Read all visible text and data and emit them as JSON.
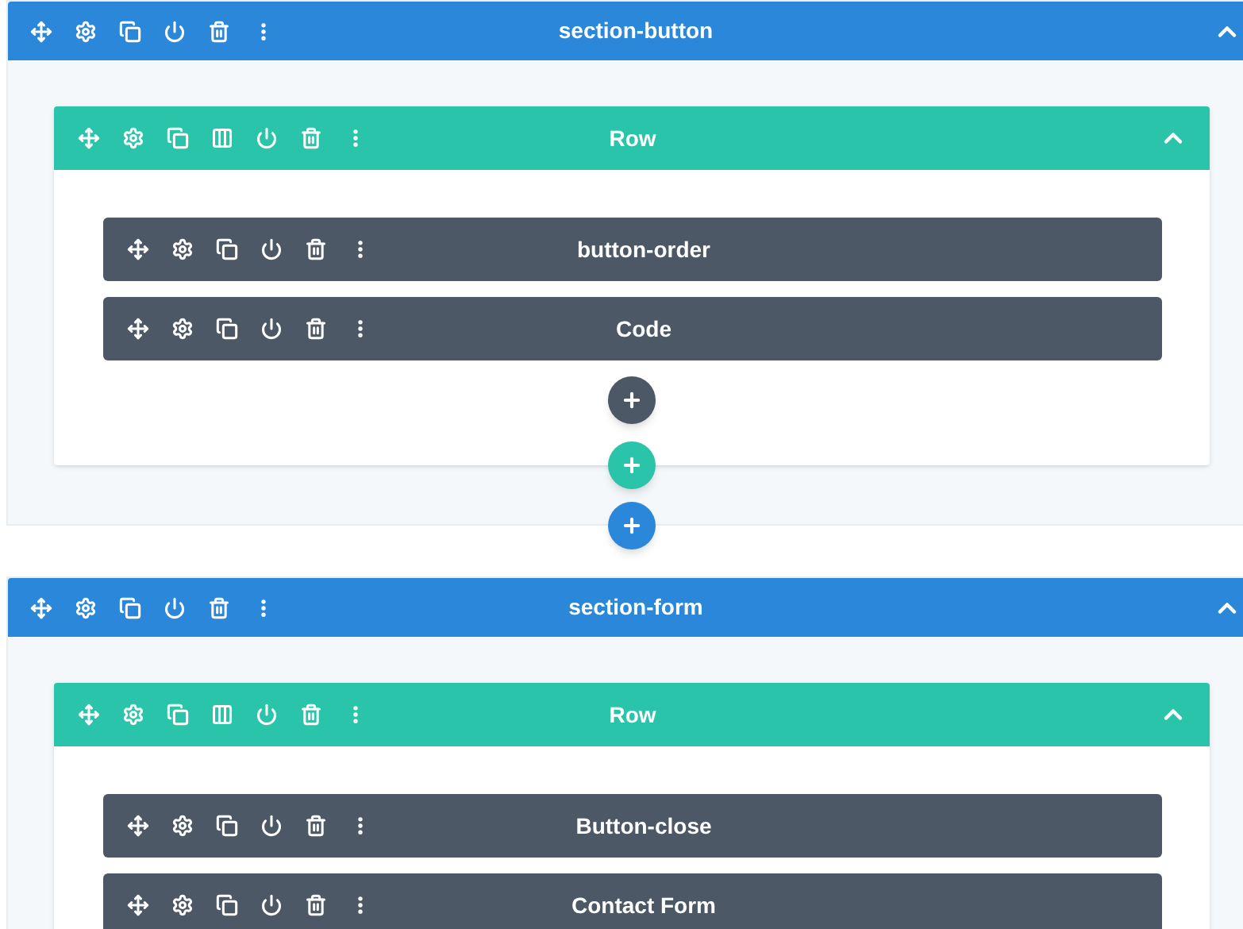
{
  "sections": [
    {
      "title": "section-button",
      "expanded": true,
      "add_section_button": true,
      "rows": [
        {
          "title": "Row",
          "expanded": true,
          "add_row_button": true,
          "add_module_button": true,
          "modules": [
            {
              "title": "button-order"
            },
            {
              "title": "Code"
            }
          ]
        }
      ]
    },
    {
      "title": "section-form",
      "expanded": true,
      "add_section_button": false,
      "rows": [
        {
          "title": "Row",
          "expanded": true,
          "add_row_button": false,
          "add_module_button": false,
          "modules": [
            {
              "title": "Button-close"
            },
            {
              "title": "Contact Form"
            }
          ]
        }
      ]
    }
  ]
}
